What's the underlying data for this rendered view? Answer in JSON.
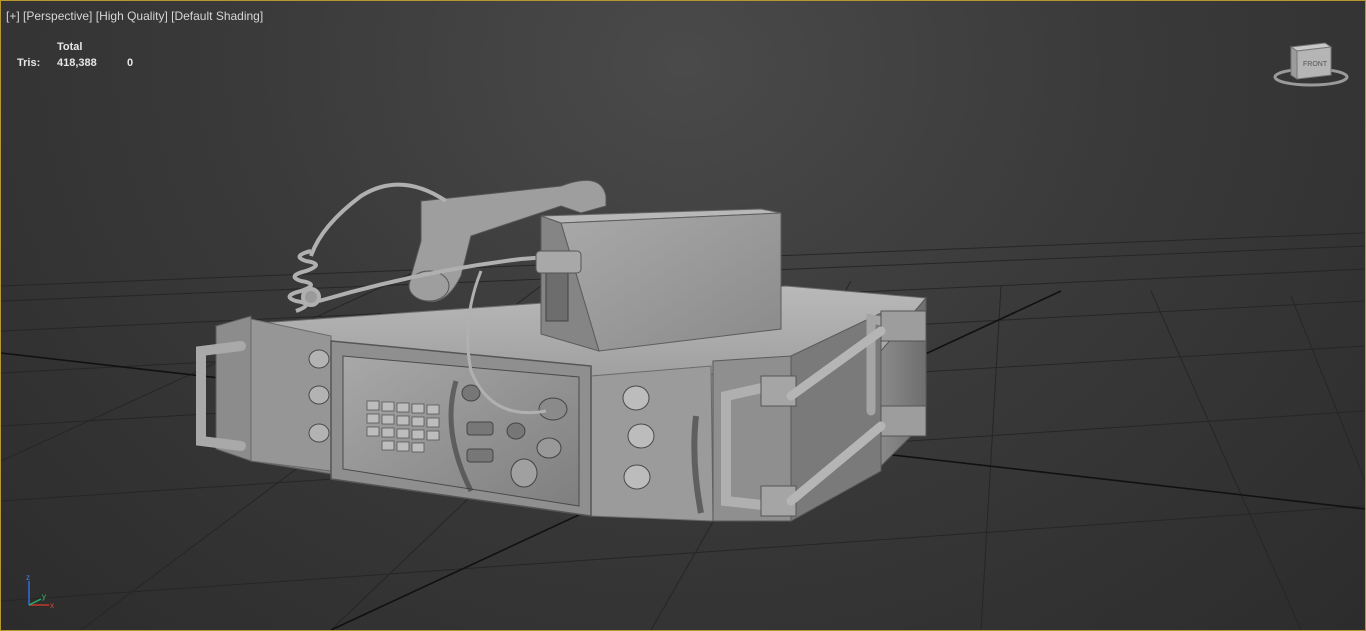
{
  "viewport": {
    "label_plus": "[+]",
    "label_view": "[Perspective]",
    "label_quality": "[High Quality]",
    "label_shading": "[Default Shading]"
  },
  "stats": {
    "total_label": "Total",
    "tris_label": "Tris:",
    "tris_total": "418,388",
    "tris_selected": "0"
  },
  "viewcube": {
    "face_label": "FRONT"
  },
  "axis": {
    "z_label": "z",
    "x_label": "x",
    "y_label": "y"
  },
  "colors": {
    "viewport_border": "#b8972f",
    "model_gray": "#a6a6a6",
    "axis_x": "#c0392b",
    "axis_y": "#27ae60",
    "axis_z": "#2f6fd6"
  }
}
